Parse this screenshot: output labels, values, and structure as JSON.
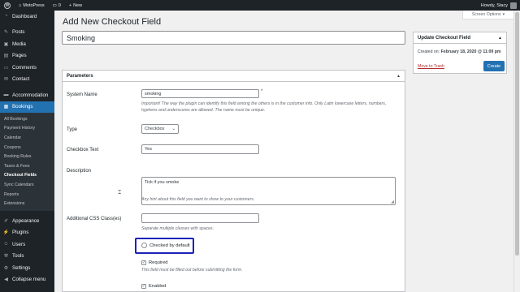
{
  "adminbar": {
    "site_name": "MotoPress",
    "comments_count": "0",
    "new_label": "New",
    "greeting": "Howdy, Stacy"
  },
  "sidebar": {
    "items_top": [
      {
        "label": "Dashboard",
        "icon": "dashboard-icon"
      }
    ],
    "items_mid": [
      {
        "label": "Posts",
        "icon": "pin-icon"
      },
      {
        "label": "Media",
        "icon": "media-icon"
      },
      {
        "label": "Pages",
        "icon": "page-icon"
      },
      {
        "label": "Comments",
        "icon": "comment-icon"
      },
      {
        "label": "Contact",
        "icon": "mail-icon"
      }
    ],
    "items_booking": [
      {
        "label": "Accommodation",
        "icon": "bed-icon"
      },
      {
        "label": "Bookings",
        "icon": "calendar-icon"
      }
    ],
    "submenu": [
      "All Bookings",
      "Payment History",
      "Calendar",
      "Coupons",
      "Booking Rules",
      "Taxes & Fees",
      "Checkout Fields",
      "Sync Calendars",
      "Reports",
      "Extensions"
    ],
    "items_bottom": [
      {
        "label": "Appearance",
        "icon": "brush-icon"
      },
      {
        "label": "Plugins",
        "icon": "plugin-icon"
      },
      {
        "label": "Users",
        "icon": "user-icon"
      },
      {
        "label": "Tools",
        "icon": "wrench-icon"
      },
      {
        "label": "Settings",
        "icon": "settings-icon"
      },
      {
        "label": "Collapse menu",
        "icon": "collapse-icon"
      }
    ]
  },
  "screen_options": "Screen Options",
  "page_title": "Add New Checkout Field",
  "title_value": "Smoking",
  "parameters": {
    "heading": "Parameters",
    "system_name_label": "System Name",
    "system_name_value": "smoking",
    "required_mark": "*",
    "system_name_hint": "Important! The way the plugin can identify this field among the others is in the customer info. Only Latin lowercase letters, numbers, hyphens and underscores are allowed. The name must be unique.",
    "type_label": "Type",
    "type_value": "Checkbox",
    "checkbox_text_label": "Checkbox Text",
    "checkbox_text_value": "Yes",
    "description_label": "Description",
    "description_value": "Tick if you smoke",
    "description_hint": "Any hint about this field you want to show to your customers.",
    "css_label": "Additional CSS Class(es)",
    "css_value": "",
    "css_hint": "Separate multiple classes with spaces.",
    "checked_default_label": "Checked by default",
    "required_label": "Required",
    "required_hint": "This field must be filled out before submitting the form.",
    "enabled_label": "Enabled"
  },
  "update_box": {
    "heading": "Update Checkout Field",
    "created_prefix": "Created on:",
    "created_date": "February 18, 2020 @ 11:09 pm",
    "trash_label": "Move to Trash",
    "create_label": "Create"
  }
}
